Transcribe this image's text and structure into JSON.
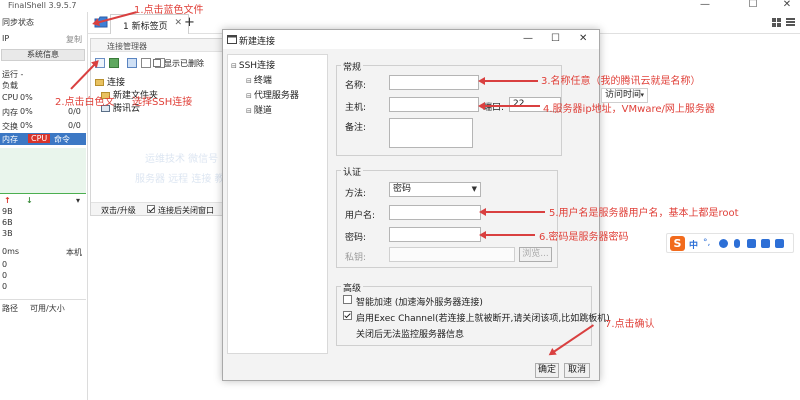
{
  "app": {
    "title": "FinalShell 3.9.5.7",
    "minimize": "—",
    "maximize": "☐",
    "close": "✕"
  },
  "sidebar": {
    "sync_status": "同步状态",
    "ip_label": "IP",
    "copy": "复制",
    "sysinfo_btn": "系统信息",
    "run_label": "运行 -",
    "load_label": "负载",
    "cpu_label": "CPU",
    "cpu_val": "0%",
    "mem_label": "内存",
    "mem_val": "0%",
    "mem_ratio": "0/0",
    "swap_label": "交换",
    "swap_val": "0%",
    "swap_ratio": "0/0",
    "tabs": [
      "内存",
      "CPU",
      "命令"
    ],
    "net_up": "↑",
    "net_down": "↓",
    "net_vals": [
      "9B",
      "6B",
      "3B"
    ],
    "ping": "0ms",
    "local": "本机",
    "zeros": [
      "0",
      "0",
      "0"
    ],
    "path_col": "路径",
    "size_col": "可用/大小"
  },
  "tabbar": {
    "tab_label": "1 新标签页",
    "tab_close": "✕",
    "add": "+"
  },
  "connmgr": {
    "title": "连接管理器",
    "show_deleted": "显示已删除",
    "tree": [
      "连接",
      "新建文件夹",
      "腾讯云"
    ],
    "footer_left": "双击/升级",
    "footer_check": "连接后关闭窗口"
  },
  "blur_text": [
    "运维技术 微信号 FinalShell 配置",
    "服务器 远程 连接 教程 笔记"
  ],
  "dialog": {
    "title": "新建连接",
    "nav": [
      {
        "label": "SSH连接",
        "expander": "⊟"
      },
      {
        "label": "终端",
        "expander": "⊟"
      },
      {
        "label": "代理服务器",
        "expander": "⊟"
      },
      {
        "label": "隧道",
        "expander": "⊟"
      }
    ],
    "general": {
      "legend": "常规",
      "name_label": "名称:",
      "name_value": "",
      "host_label": "主机:",
      "host_value": "",
      "port_label": "端口:",
      "port_value": "22",
      "note_label": "备注:",
      "visit_time": "访问时间"
    },
    "auth": {
      "legend": "认证",
      "method_label": "方法:",
      "method_value": "密码",
      "user_label": "用户名:",
      "user_value": "",
      "pass_label": "密码:",
      "pass_value": "",
      "key_label": "私钥:",
      "browse": "浏览..."
    },
    "advanced": {
      "legend": "高级",
      "smart_accel": "智能加速 (加速海外服务器连接)",
      "exec_channel": "启用Exec Channel(若连接上就被断开,请关闭该项,比如跳板机)",
      "no_monitor": "关闭后无法监控服务器信息"
    },
    "ok": "确定",
    "cancel": "取消"
  },
  "annotations": {
    "a1": "1.点击蓝色文件",
    "a2_left": "2.点击白色文",
    "a2_right": "选择SSH连接",
    "a3": "3.名称任意（我的腾讯云就是名称）",
    "a4": "4.服务器ip地址，VMware/网上服务器",
    "a5": "5.用户名是服务器用户名，基本上都是root",
    "a6": "6.密码是服务器密码",
    "a7": "7.点击确认"
  },
  "ime": {
    "logo": "S",
    "lang": "中",
    "punct": "°,"
  }
}
